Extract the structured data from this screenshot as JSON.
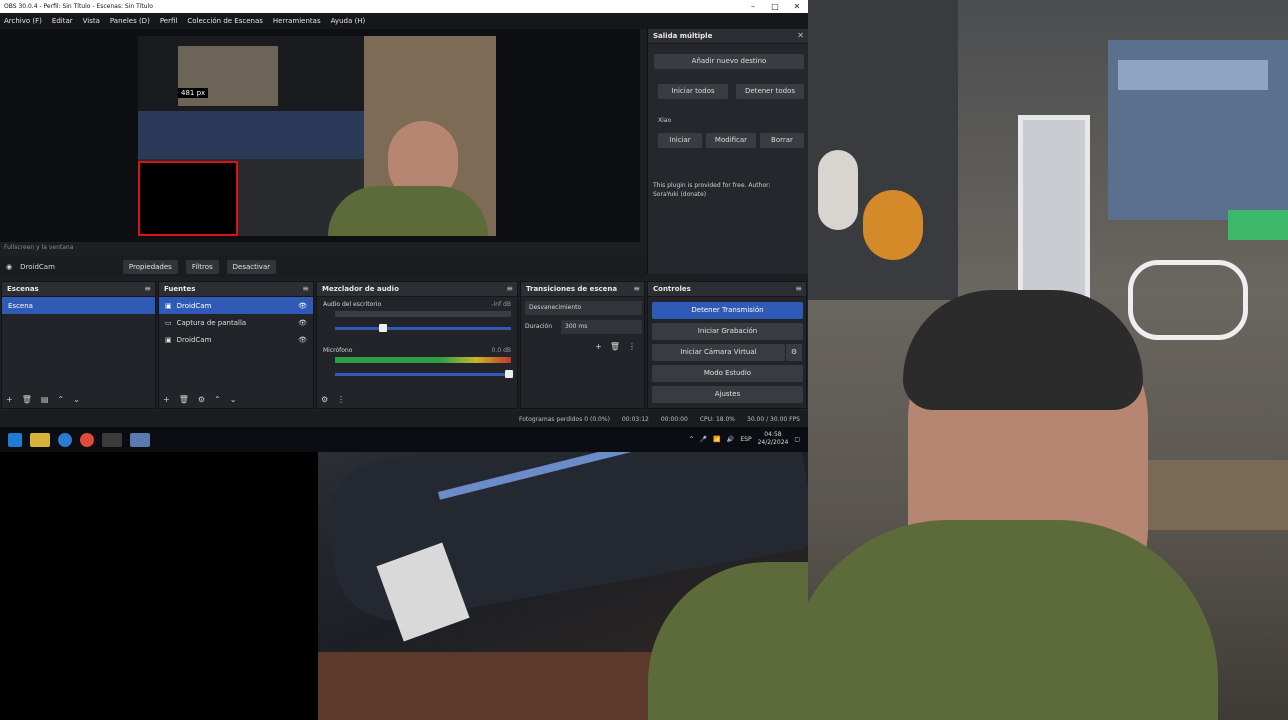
{
  "window": {
    "title": "OBS 30.0.4 - Perfil: Sin Título - Escenas: Sin Título"
  },
  "menu": [
    "Archivo (F)",
    "Editar",
    "Vista",
    "Paneles (D)",
    "Perfil",
    "Colección de Escenas",
    "Herramientas",
    "Ayuda (H)"
  ],
  "preview": {
    "tooltip": "481 px",
    "bottom_hint": "Fullscreen y la ventana"
  },
  "source_toolbar": {
    "source_name": "DroidCam",
    "buttons": [
      "Propiedades",
      "Filtros",
      "Desactivar"
    ]
  },
  "multi_output": {
    "title": "Salida múltiple",
    "add_target": "Añadir nuevo destino",
    "start_all": "Iniciar todos",
    "stop_all": "Detener todos",
    "section_label": "Xiao",
    "item_buttons": [
      "Iniciar",
      "Modificar",
      "Borrar"
    ],
    "footer_text": "This plugin is provided for free. Author: SoraYuki (donate)"
  },
  "scenes": {
    "title": "Escenas",
    "items": [
      "Escena"
    ]
  },
  "sources": {
    "title": "Fuentes",
    "items": [
      {
        "name": "DroidCam"
      },
      {
        "name": "Captura de pantalla"
      },
      {
        "name": "DroidCam"
      }
    ]
  },
  "audio_mixer": {
    "title": "Mezclador de audio",
    "channels": [
      {
        "name": "Audio del escritorio",
        "level": "-inf dB"
      },
      {
        "name": "Micrófono",
        "level": "0.0 dB"
      }
    ]
  },
  "transitions": {
    "title": "Transiciones de escena",
    "type": "Desvanecimiento",
    "duration_label": "Duración",
    "duration_value": "300 ms"
  },
  "controls": {
    "title": "Controles",
    "buttons": [
      "Detener Transmisión",
      "Iniciar Grabación",
      "Iniciar Cámara Virtual",
      "Modo Estudio",
      "Ajustes"
    ]
  },
  "status": {
    "dropped": "Fotogramas perdidos 0 (0.0%)",
    "live": "00:03:12",
    "rec": "00:00:00",
    "cpu": "CPU: 18.0%",
    "fps": "30.00 / 30.00 FPS"
  },
  "taskbar": {
    "time": "04:58",
    "date": "24/2/2024",
    "lang": "ESP"
  },
  "colors": {
    "accent": "#2f5bb7",
    "panel": "#23242a",
    "dock_header": "#2d2e33",
    "window": "#1e1f23"
  }
}
